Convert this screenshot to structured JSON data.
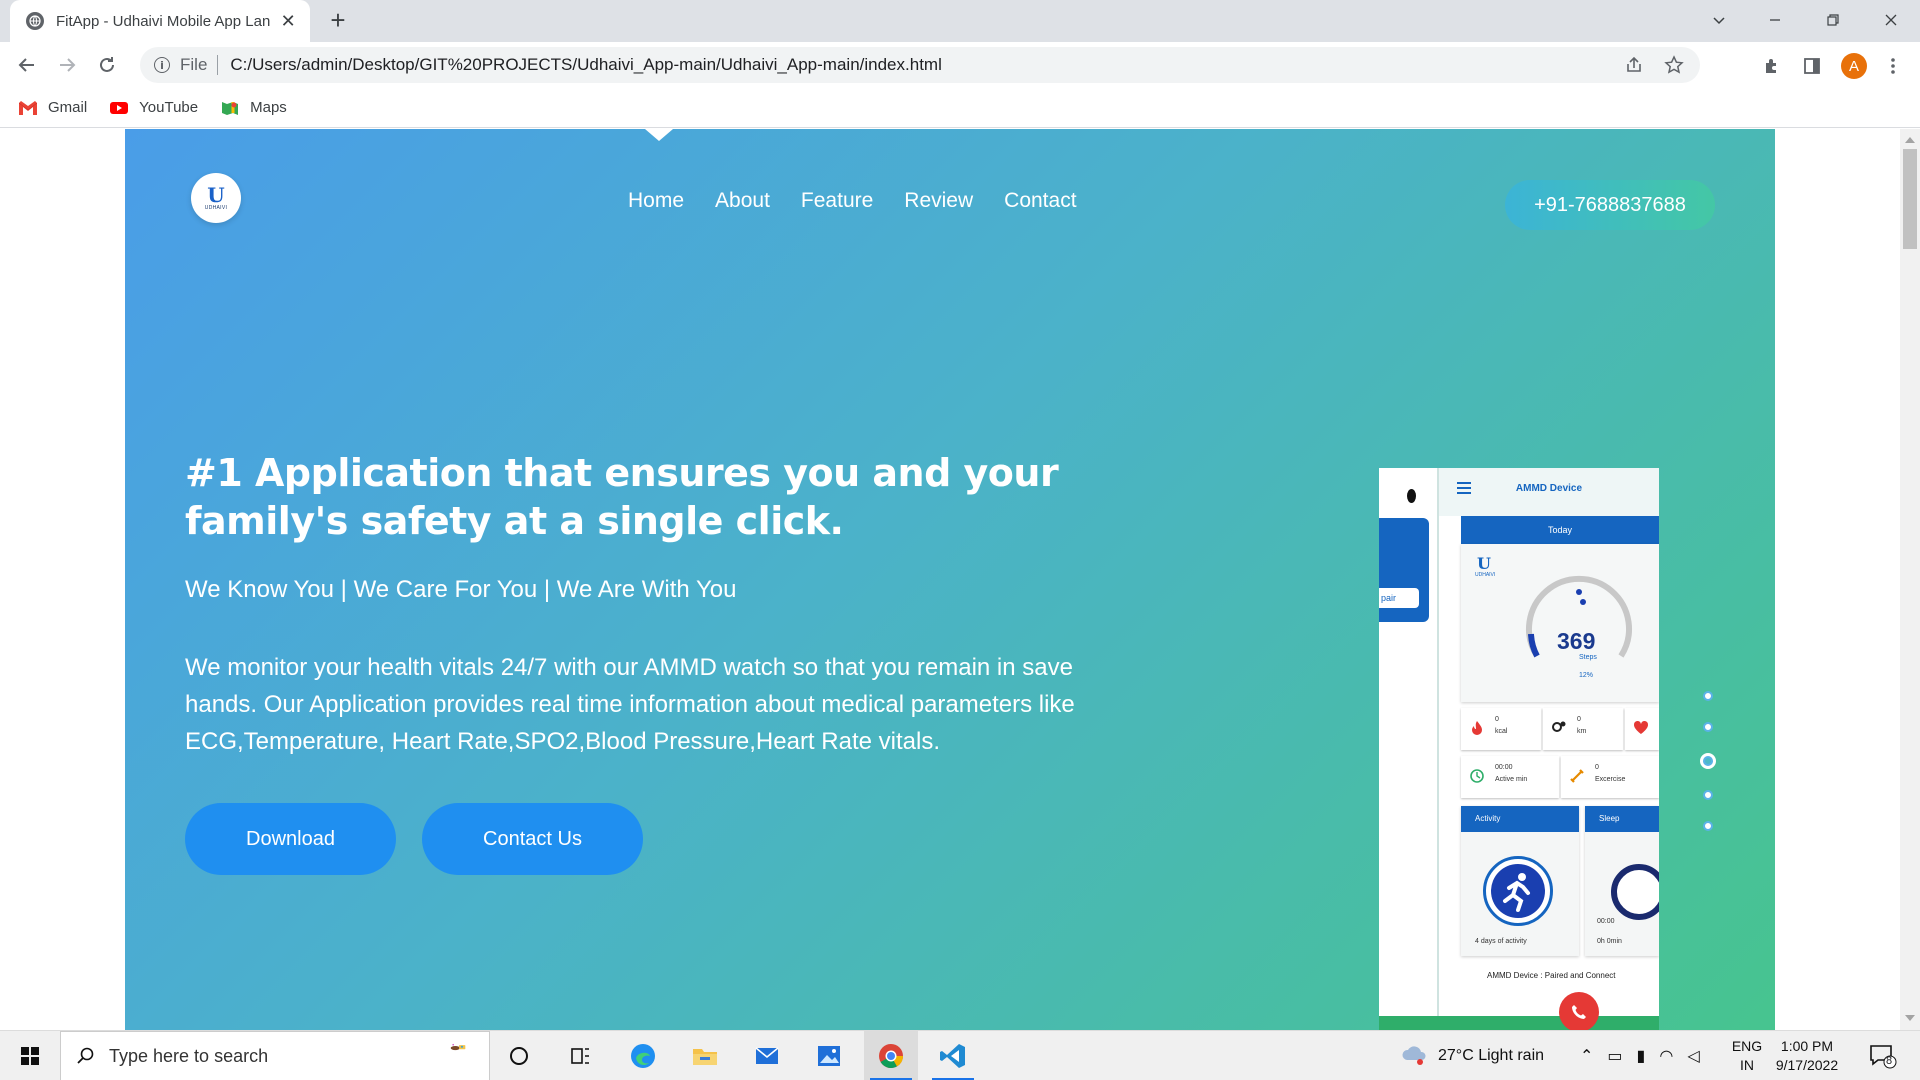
{
  "browser": {
    "tab_title": "FitApp - Udhaivi Mobile App Lan",
    "omnibox_scheme": "File",
    "url": "C:/Users/admin/Desktop/GIT%20PROJECTS/Udhaivi_App-main/Udhaivi_App-main/index.html",
    "profile_initial": "A",
    "bookmarks": [
      {
        "label": "Gmail",
        "icon": "gmail-icon"
      },
      {
        "label": "YouTube",
        "icon": "youtube-icon"
      },
      {
        "label": "Maps",
        "icon": "maps-icon"
      }
    ]
  },
  "page": {
    "logo": {
      "mark": "U",
      "text": "UDHAIVI"
    },
    "nav": [
      "Home",
      "About",
      "Feature",
      "Review",
      "Contact"
    ],
    "phone_number": "+91-7688837688",
    "headline": "#1 Application that ensures you and your family's safety at a single click.",
    "tagline": "We Know You | We Care For You | We Are With You",
    "description": "We monitor your health vitals 24/7 with our AMMD watch so that you remain in save hands. Our Application provides real time information about medical parameters like ECG,Temperature, Heart Rate,SPO2,Blood Pressure,Heart Rate vitals.",
    "buttons": {
      "download": "Download",
      "contact": "Contact Us"
    },
    "pager": {
      "count": 5,
      "active_index": 2
    }
  },
  "app_mock": {
    "title": "AMMD Device",
    "side_button": "pair",
    "today": "Today",
    "brand_mark": "U",
    "brand_text": "UDHAIVI",
    "steps": "369",
    "steps_label": "Steps",
    "steps_progress": "12%",
    "kcal_value": "0",
    "kcal_label": "kcal",
    "km_value": "0",
    "km_label": "km",
    "active_time": "00:00",
    "active_label": "Active min",
    "exercise_value": "0",
    "exercise_label": "Excercise",
    "activity_title": "Activity",
    "activity_text": "4 days of activity",
    "sleep_title": "Sleep",
    "sleep_time": "00:00",
    "sleep_duration": "0h 0min",
    "status": "AMMD Device : Paired and Connect"
  },
  "taskbar": {
    "search_placeholder": "Type here to search",
    "weather": "27°C  Light rain",
    "lang_1": "ENG",
    "lang_2": "IN",
    "time": "1:00 PM",
    "date": "9/17/2022",
    "notifications": "8"
  },
  "colors": {
    "hero_start": "#4a9de8",
    "hero_end": "#47c48f",
    "button_blue": "#1f8ff0",
    "app_blue": "#1565c0"
  }
}
